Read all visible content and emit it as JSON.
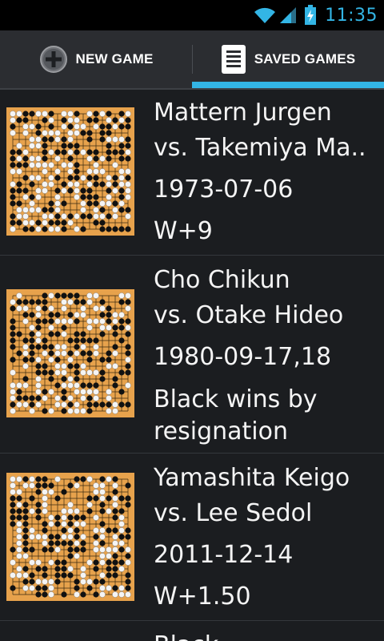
{
  "status_bar": {
    "time": "11:35",
    "icons": [
      "wifi-icon",
      "signal-icon",
      "battery-charging-icon"
    ]
  },
  "tabs": [
    {
      "label": "NEW GAME",
      "icon": "add-circle-icon",
      "selected": false
    },
    {
      "label": "SAVED GAMES",
      "icon": "document-list-icon",
      "selected": true
    }
  ],
  "games": [
    {
      "black": "Mattern Jurgen",
      "white": "vs.  Takemiya Ma..",
      "date": "1973-07-06",
      "result": "W+9"
    },
    {
      "black": "Cho Chikun",
      "white": "vs.  Otake Hideo",
      "date": "1980-09-17,18",
      "result": "Black wins by resignation"
    },
    {
      "black": "Yamashita Keigo",
      "white": "vs.  Lee Sedol",
      "date": "2011-12-14",
      "result": "W+1.50"
    },
    {
      "black": "Black",
      "white": "",
      "date": "",
      "result": ""
    }
  ],
  "colors": {
    "accent": "#33b5e5",
    "board": "#e7a24c",
    "background": "#1b1d20"
  }
}
